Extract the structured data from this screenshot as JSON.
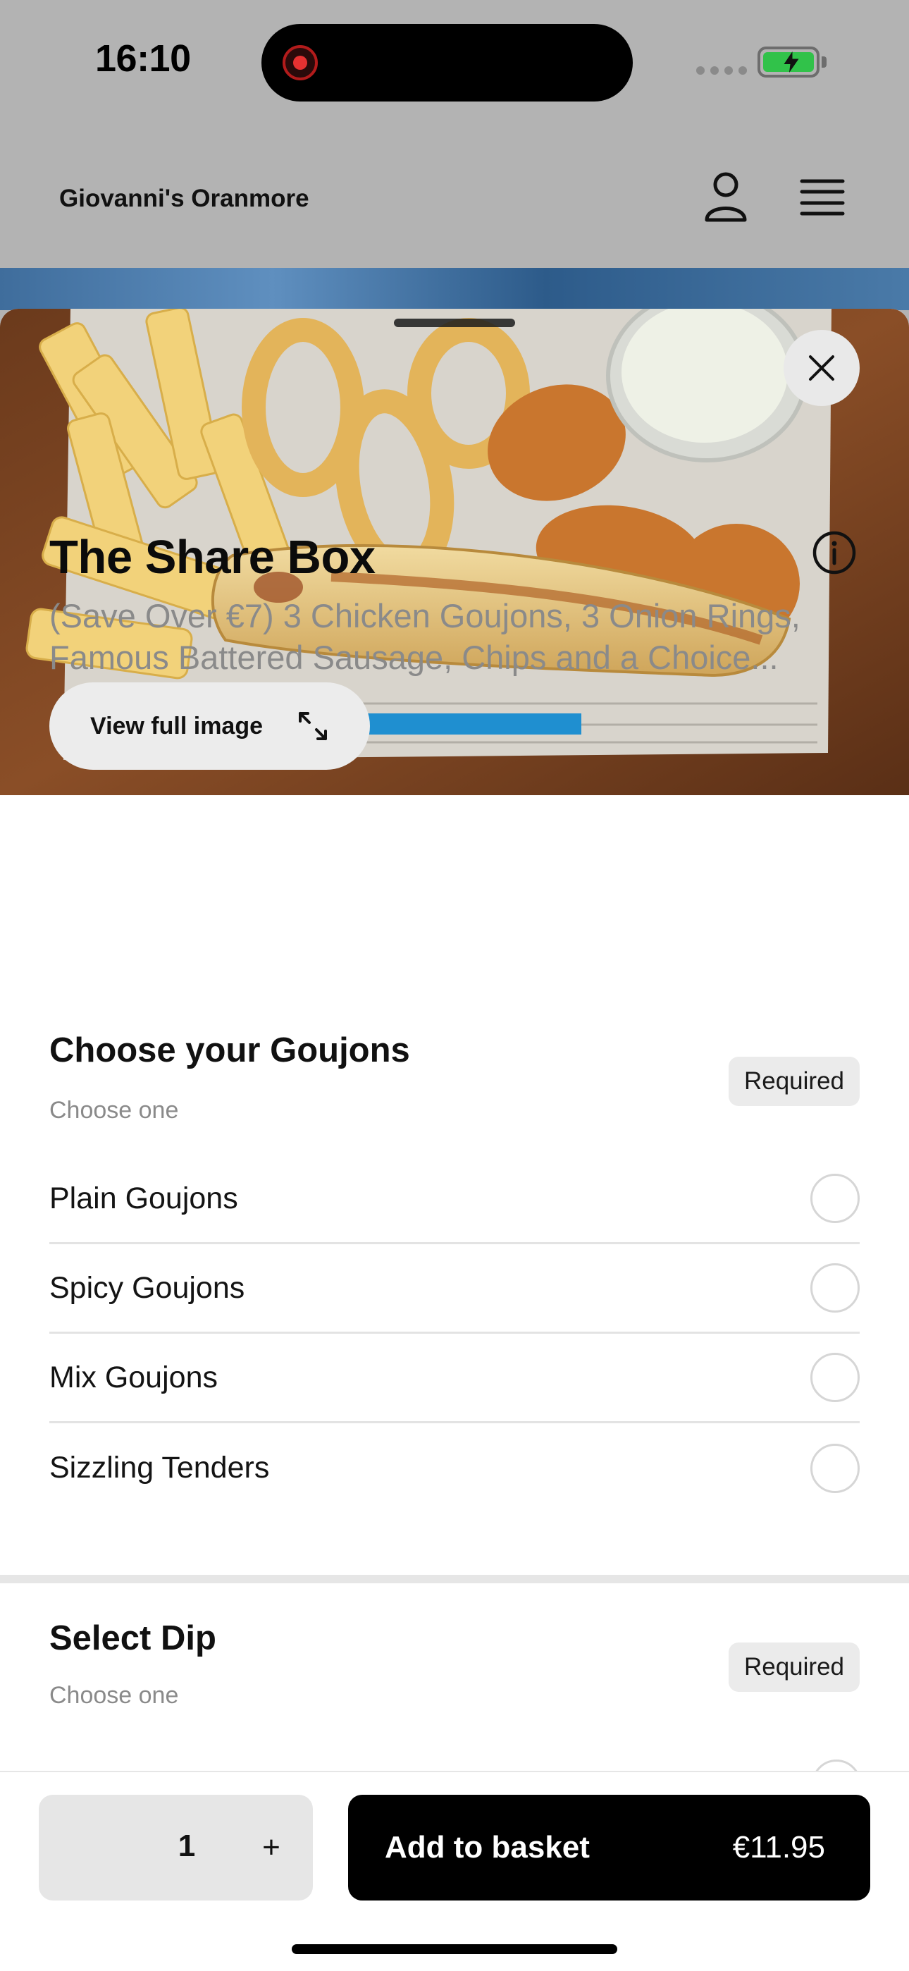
{
  "status_bar": {
    "time": "16:10"
  },
  "header": {
    "store_name": "Giovanni's Oranmore"
  },
  "hero": {
    "view_full_image_label": "View full image"
  },
  "product": {
    "title": "The Share Box",
    "description": "(Save Over €7) 3 Chicken Goujons, 3 Onion Rings, Famous Battered Sausage, Chips and a Choice..."
  },
  "groups": [
    {
      "title": "Choose your Goujons",
      "subtitle": "Choose one",
      "badge": "Required",
      "options": [
        "Plain Goujons",
        "Spicy Goujons",
        "Mix Goujons",
        "Sizzling Tenders"
      ]
    },
    {
      "title": "Select Dip",
      "subtitle": "Choose one",
      "badge": "Required"
    }
  ],
  "footer": {
    "quantity": "1",
    "plus_label": "+",
    "add_label": "Add to basket",
    "price": "€11.95"
  },
  "colors": {
    "accent": "#000000",
    "muted_text": "#8a8a8a",
    "badge_bg": "#ebebeb"
  }
}
